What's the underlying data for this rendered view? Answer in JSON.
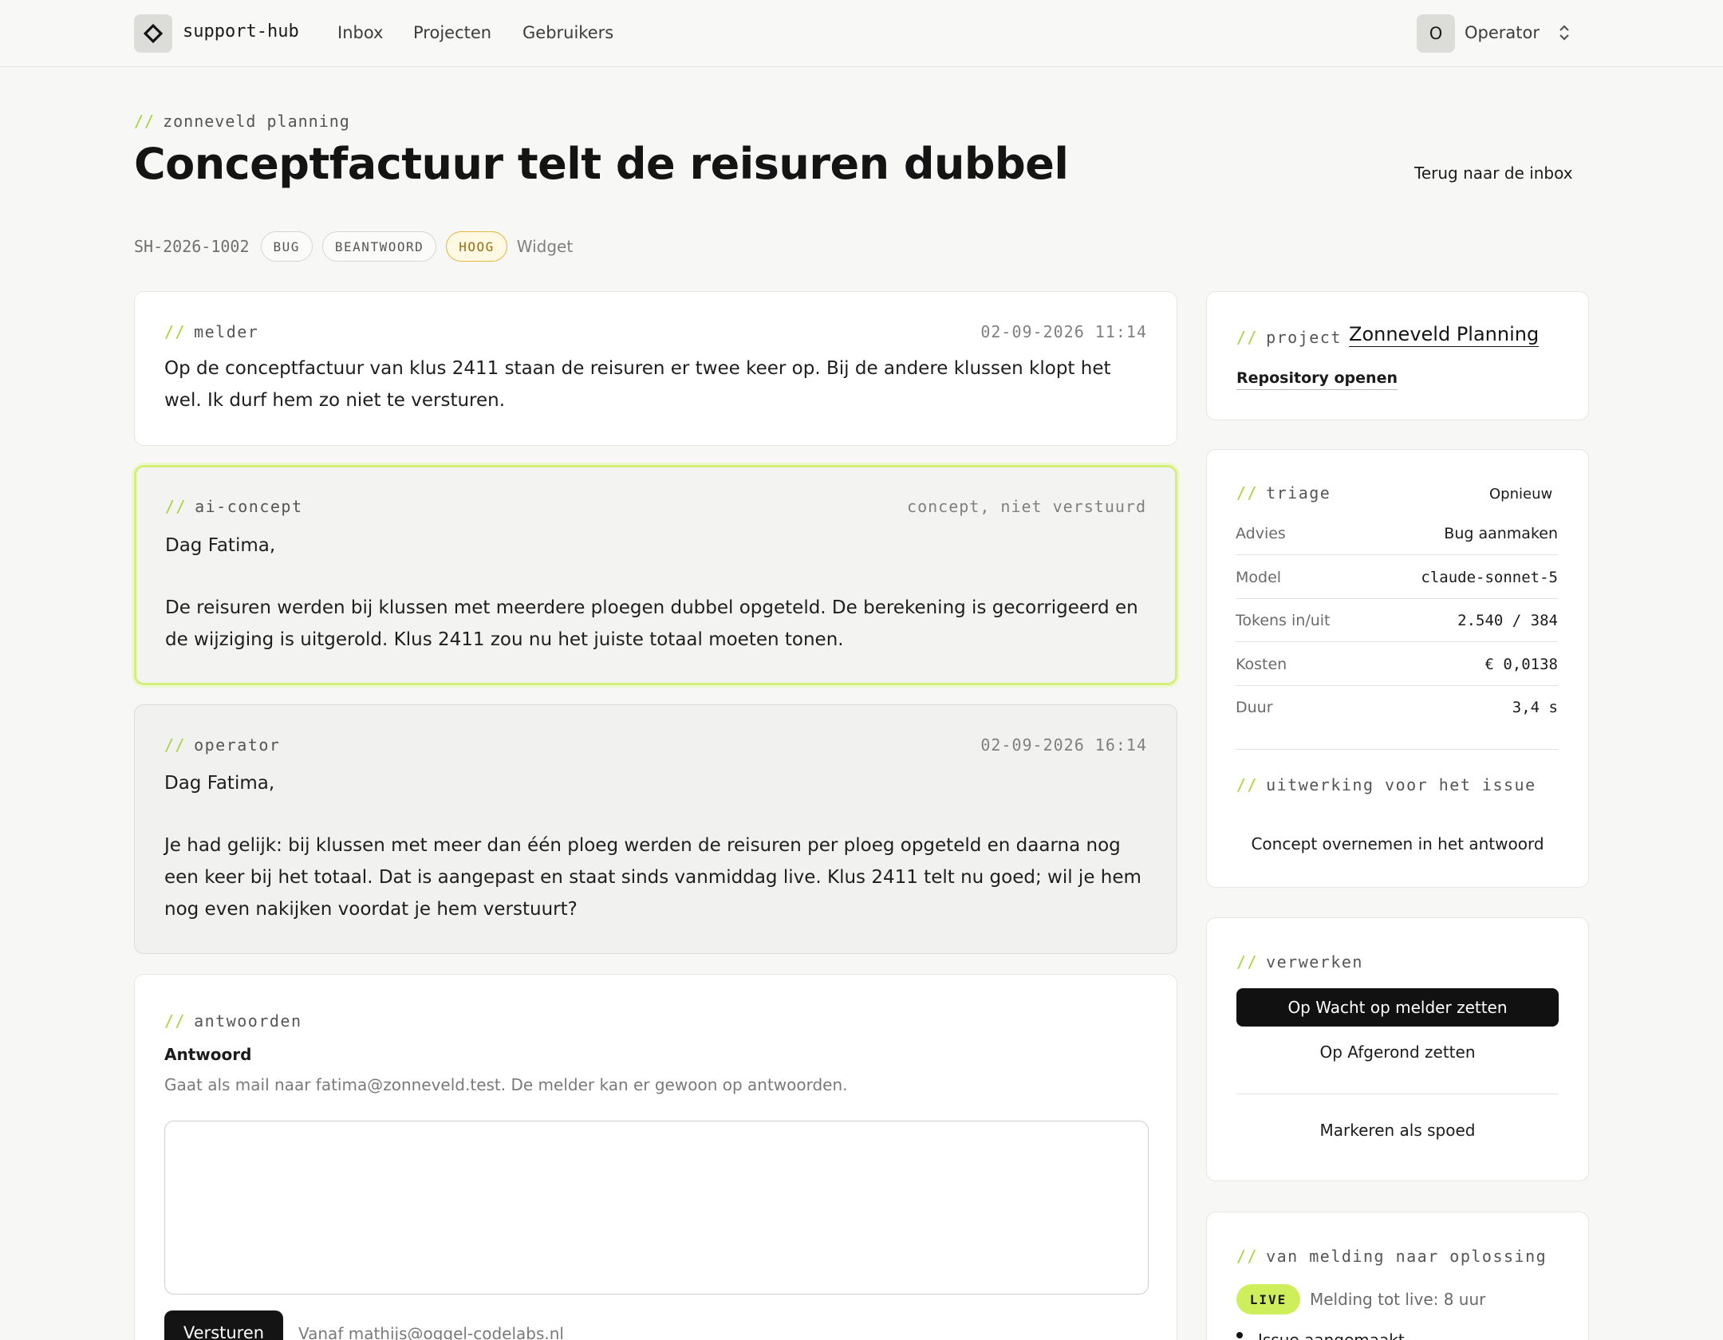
{
  "app": {
    "name": "support-hub",
    "nav": [
      "Inbox",
      "Projecten",
      "Gebruikers"
    ],
    "user": {
      "initial": "O",
      "name": "Operator"
    }
  },
  "header": {
    "eyebrow": "zonneveld planning",
    "title": "Conceptfactuur telt de reisuren dubbel",
    "back_link": "Terug naar de inbox",
    "ticket_id": "SH-2026-1002",
    "badges": [
      "BUG",
      "BEANTWOORD",
      "HOOG"
    ],
    "channel": "Widget"
  },
  "thread": {
    "reporter": {
      "label": "melder",
      "timestamp": "02-09-2026 11:14",
      "body": "Op de conceptfactuur van klus 2411 staan de reisuren er twee keer op. Bij de andere klussen klopt het wel. Ik durf hem zo niet te versturen."
    },
    "ai_draft": {
      "label": "ai-concept",
      "status": "concept, niet verstuurd",
      "greeting": "Dag Fatima,",
      "body": "De reisuren werden bij klussen met meerdere ploegen dubbel opgeteld. De berekening is gecorrigeerd en de wijziging is uitgerold. Klus 2411 zou nu het juiste totaal moeten tonen."
    },
    "operator": {
      "label": "operator",
      "timestamp": "02-09-2026 16:14",
      "greeting": "Dag Fatima,",
      "body": "Je had gelijk: bij klussen met meer dan één ploeg werden de reisuren per ploeg opgeteld en daarna nog een keer bij het totaal. Dat is aangepast en staat sinds vanmiddag live. Klus 2411 telt nu goed; wil je hem nog even nakijken voordat je hem verstuurt?"
    },
    "reply": {
      "label": "antwoorden",
      "field_label": "Antwoord",
      "help": "Gaat als mail naar fatima@zonneveld.test. De melder kan er gewoon op antwoorden.",
      "value": "",
      "send_label": "Versturen",
      "from": "Vanaf mathijs@oggel-codelabs.nl"
    }
  },
  "sidebar": {
    "project": {
      "label": "project",
      "name": "Zonneveld Planning",
      "repo_link": "Repository openen"
    },
    "triage": {
      "label": "triage",
      "retry": "Opnieuw",
      "rows": [
        {
          "key": "Advies",
          "value": "Bug aanmaken"
        },
        {
          "key": "Model",
          "value": "claude-sonnet-5"
        },
        {
          "key": "Tokens in/uit",
          "value": "2.540 / 384"
        },
        {
          "key": "Kosten",
          "value": "€ 0,0138"
        },
        {
          "key": "Duur",
          "value": "3,4 s"
        }
      ],
      "issue_label": "uitwerking voor het issue",
      "adopt_button": "Concept overnemen in het antwoord"
    },
    "process": {
      "label": "verwerken",
      "wait_button": "Op Wacht op melder zetten",
      "done_button": "Op Afgerond zetten",
      "urgent_button": "Markeren als spoed"
    },
    "timeline": {
      "label": "van melding naar oplossing",
      "live_badge": "LIVE",
      "live_text": "Melding tot live: 8  uur",
      "first_item": "Issue aangemaakt"
    }
  },
  "colors": {
    "accent": "#a6d43a",
    "live": "#cfee5c",
    "high_badge": "#e2b63a",
    "primary": "#111111"
  }
}
